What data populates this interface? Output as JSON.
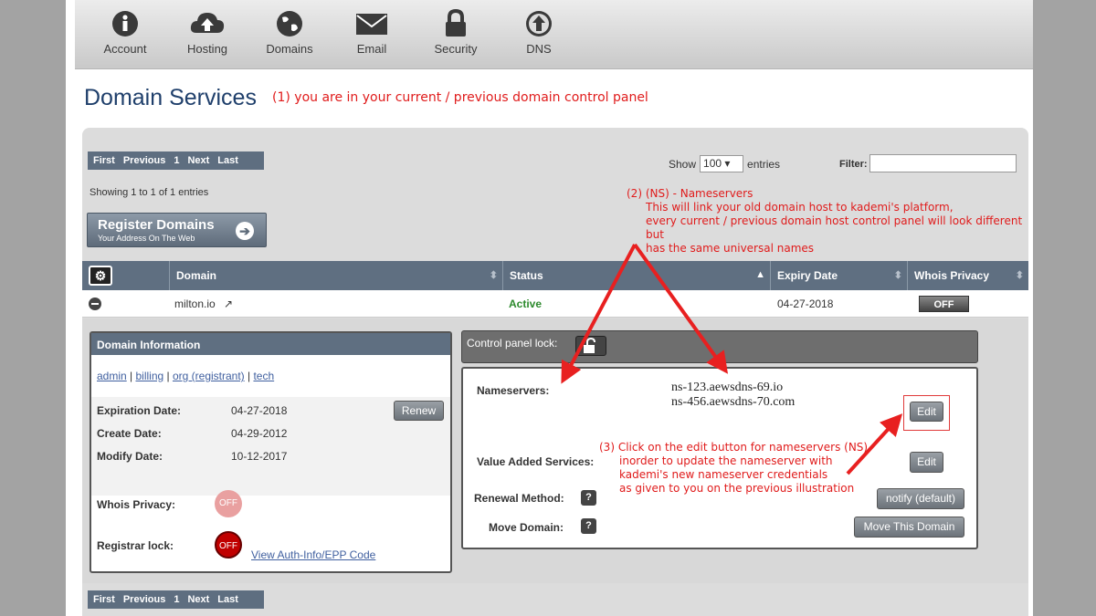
{
  "nav": {
    "items": [
      {
        "label": "Account",
        "icon": "info-icon"
      },
      {
        "label": "Hosting",
        "icon": "cloud-upload-icon"
      },
      {
        "label": "Domains",
        "icon": "globe-icon"
      },
      {
        "label": "Email",
        "icon": "envelope-icon"
      },
      {
        "label": "Security",
        "icon": "lock-icon"
      },
      {
        "label": "DNS",
        "icon": "upload-circle-icon"
      }
    ]
  },
  "page": {
    "title": "Domain Services"
  },
  "annotations": {
    "a1": "(1) you are in your current / previous domain control panel",
    "a2_l1": "(2)  (NS) - Nameservers",
    "a2_l2": "This will link your old domain host to kademi's platform,",
    "a2_l3": "every current / previous domain host control panel will look different but",
    "a2_l4": "has the same universal names",
    "a3_l1": "(3)  Click on the edit button for nameservers (NS)",
    "a3_l2": "inorder to update the nameserver with",
    "a3_l3": "kademi's new nameserver credentials",
    "a3_l4": "as given to you on the previous illustration",
    "color": "#e01b1b"
  },
  "pager": {
    "first": "First",
    "previous": "Previous",
    "page": "1",
    "next": "Next",
    "last": "Last"
  },
  "table_controls": {
    "show_label": "Show",
    "show_value": "100",
    "entries_label": "entries",
    "filter_label": "Filter:",
    "showing": "Showing 1 to 1 of 1 entries"
  },
  "register": {
    "title": "Register Domains",
    "subtitle": "Your Address On The Web"
  },
  "table": {
    "headers": [
      "Domain",
      "Status",
      "Expiry Date",
      "Whois Privacy"
    ],
    "row": {
      "domain": "milton.io",
      "status": "Active",
      "expiry": "04-27-2018",
      "whois": "OFF"
    }
  },
  "domain_info": {
    "header": "Domain Information",
    "contacts": [
      "admin",
      "billing",
      "org (registrant)",
      "tech"
    ],
    "expiration_label": "Expiration Date:",
    "expiration_value": "04-27-2018",
    "create_label": "Create Date:",
    "create_value": "04-29-2012",
    "modify_label": "Modify Date:",
    "modify_value": "10-12-2017",
    "renew_label": "Renew",
    "whois_label": "Whois Privacy:",
    "whois_toggle": "OFF",
    "registrar_label": "Registrar lock:",
    "registrar_toggle": "OFF",
    "auth_link": "View Auth-Info/EPP Code"
  },
  "control_panel": {
    "lock_label": "Control panel lock:",
    "nameservers_label": "Nameservers:",
    "ns1": "ns-123.aewsdns-69.io",
    "ns2": "ns-456.aewsdns-70.com",
    "edit_label": "Edit",
    "vas_label": "Value Added Services:",
    "vas_edit": "Edit",
    "renewal_label": "Renewal Method:",
    "renewal_button": "notify (default)",
    "move_label": "Move Domain:",
    "move_button": "Move This Domain"
  }
}
